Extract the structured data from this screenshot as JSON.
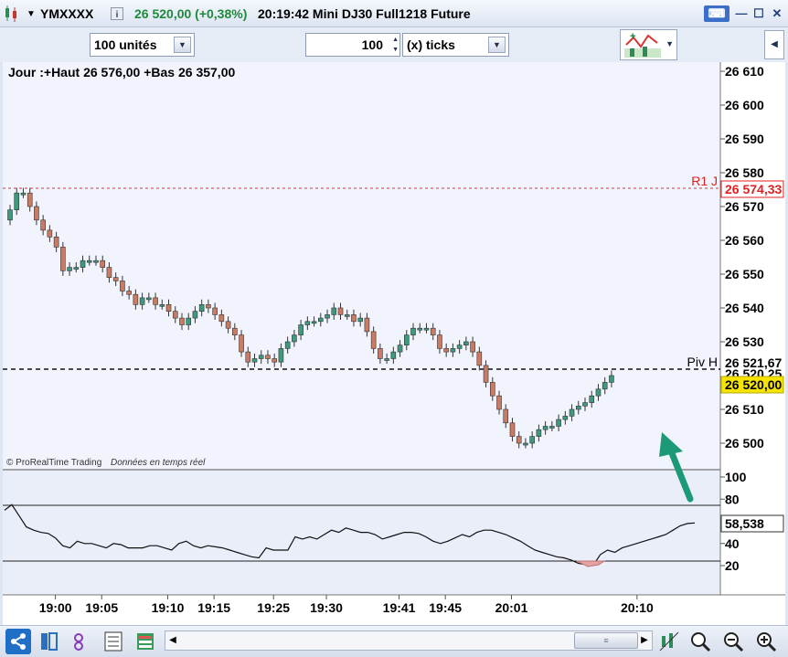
{
  "window": {
    "symbol": "YMXXXX",
    "price_change": "26 520,00 (+0,38%)",
    "time_and_name": "20:19:42 Mini DJ30 Full1218 Future"
  },
  "toolbar": {
    "units_combo": "100 unités",
    "ticks_value": "100",
    "ticks_mode": "(x) ticks"
  },
  "chart": {
    "header_text": "Jour :+Haut 26 576,00 +Bas 26 357,00",
    "watermark_brand": "© ProRealTime Trading",
    "watermark_note": "Données en temps réel",
    "r1_label": "R1 J",
    "r1_value": "26 574,33",
    "piv_label": "Piv H",
    "piv_value": "26 521,67",
    "last_value": "26 520,00",
    "last_hidden_label": "26 520,25",
    "osc_value": "58,538",
    "price_ticks": [
      "26 610",
      "26 600",
      "26 590",
      "26 580",
      "26 570",
      "26 560",
      "26 550",
      "26 540",
      "26 530",
      "26 510",
      "26 500"
    ],
    "osc_ticks": [
      "100",
      "80",
      "40",
      "20"
    ],
    "time_ticks": [
      "19:00",
      "19:05",
      "19:10",
      "19:15",
      "19:25",
      "19:30",
      "19:41",
      "19:45",
      "20:01",
      "20:10"
    ]
  },
  "colors": {
    "up": "#3d9a7c",
    "down": "#c97c63",
    "r1": "#e02020",
    "last_bg": "#f5e400",
    "panel_bg": "#eef1fb",
    "arrow": "#1c9a78"
  },
  "chart_data": {
    "type": "candlestick",
    "title": "Mini DJ30 Full1218 Future",
    "ylim": [
      26493,
      26613
    ],
    "x": [
      "19:00",
      "19:05",
      "19:10",
      "19:15",
      "19:25",
      "19:30",
      "19:41",
      "19:45",
      "20:01",
      "20:10"
    ],
    "pivots": {
      "R1 J": 26574.33,
      "Piv H": 26521.67
    },
    "last": 26520.0,
    "closes": [
      26569,
      26574,
      26574,
      26570,
      26566,
      26563,
      26561,
      26558,
      26551,
      26552,
      26552,
      26554,
      26554,
      26554,
      26552,
      26549,
      26548,
      26545,
      26544,
      26541,
      26543,
      26543,
      26541,
      26541,
      26539,
      26537,
      26535,
      26537,
      26539,
      26541,
      26540,
      26538,
      26536,
      26534,
      26532,
      26527,
      26524,
      26525,
      26526,
      26525,
      26524,
      26528,
      26530,
      26532,
      26535,
      26536,
      26536,
      26537,
      26538,
      26540,
      26538,
      26538,
      26536,
      26537,
      26533,
      26528,
      26525,
      26525,
      26527,
      26529,
      26532,
      26534,
      26534,
      26534,
      26532,
      26528,
      26527,
      26528,
      26529,
      26530,
      26527,
      26523,
      26518,
      26514,
      26510,
      26506,
      26502,
      26500,
      26500,
      26502,
      26504,
      26505,
      26505,
      26507,
      26508,
      26510,
      26511,
      26512,
      26514,
      26516,
      26518,
      26520
    ],
    "oscillator": {
      "name": "58,538",
      "ylim": [
        0,
        110
      ],
      "levels": [
        75,
        25
      ],
      "last": 58.538,
      "values": [
        70,
        75,
        65,
        55,
        52,
        50,
        49,
        45,
        38,
        36,
        42,
        40,
        40,
        38,
        36,
        40,
        39,
        36,
        36,
        36,
        38,
        38,
        36,
        34,
        40,
        42,
        38,
        36,
        38,
        37,
        36,
        34,
        32,
        30,
        28,
        27,
        36,
        34,
        34,
        34,
        46,
        44,
        46,
        44,
        48,
        52,
        50,
        54,
        52,
        50,
        50,
        48,
        44,
        46,
        48,
        50,
        50,
        49,
        46,
        42,
        40,
        42,
        45,
        48,
        46,
        50,
        52,
        52,
        50,
        48,
        45,
        42,
        38,
        34,
        32,
        30,
        28,
        27,
        25,
        22,
        21,
        20,
        30,
        34,
        32,
        36,
        38,
        40,
        42,
        44,
        46,
        48,
        52,
        56,
        58,
        58.5
      ]
    }
  }
}
